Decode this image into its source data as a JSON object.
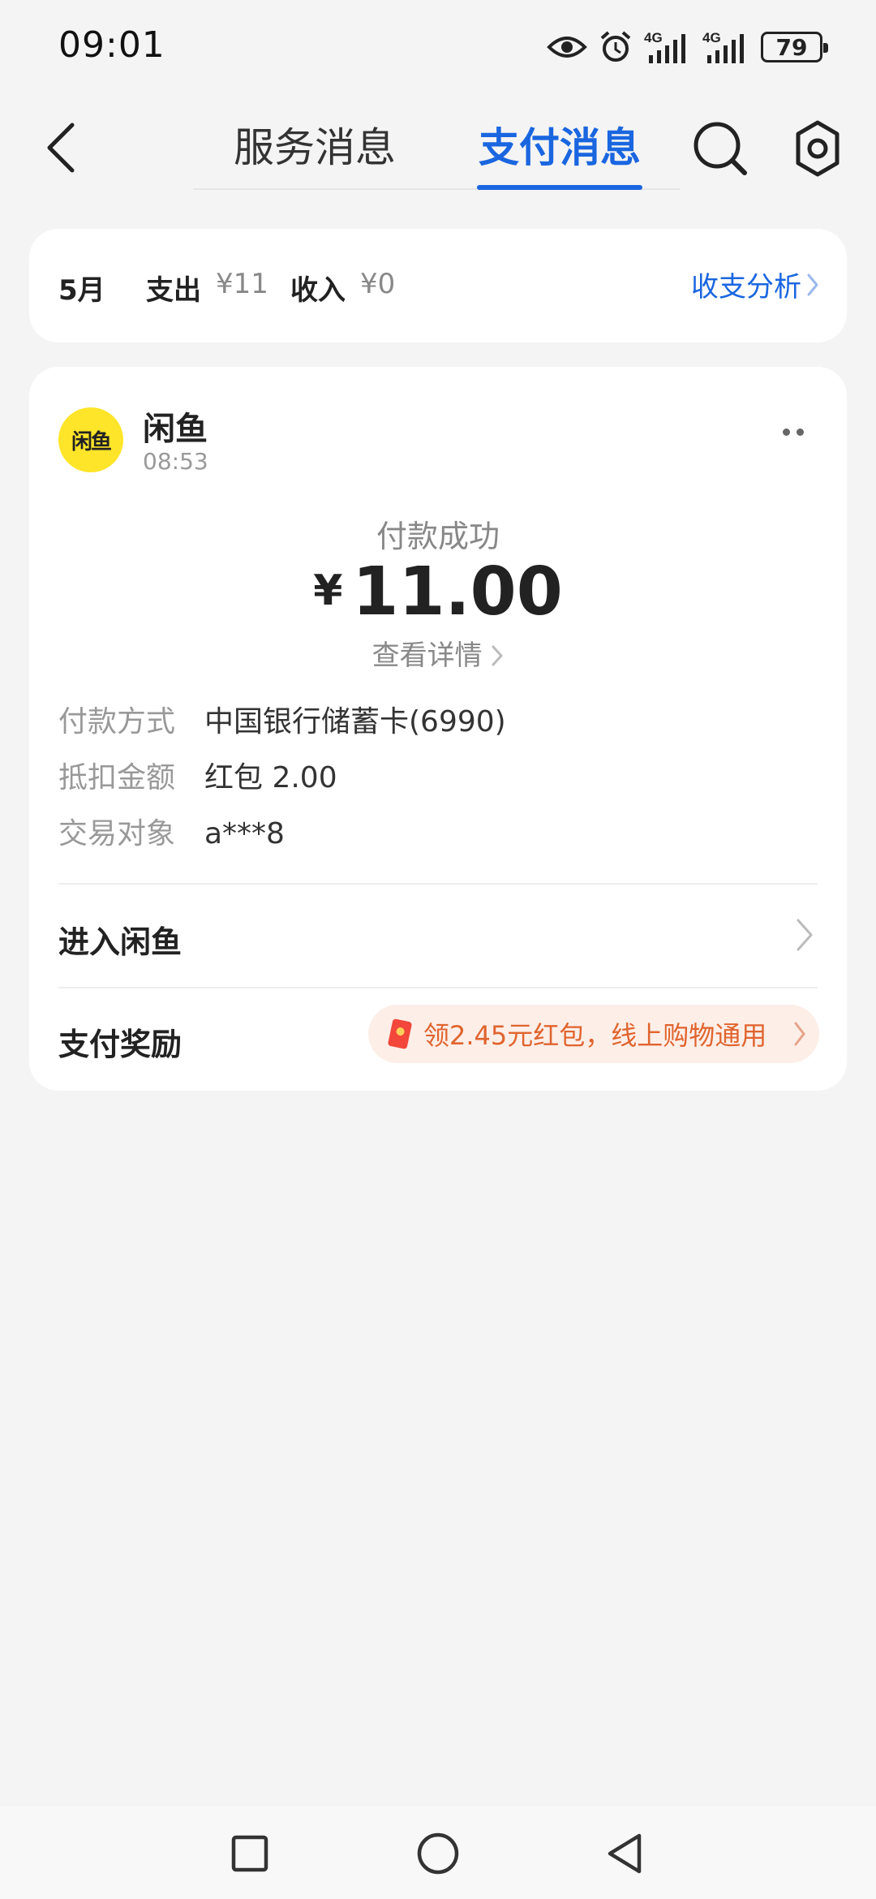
{
  "status_bar": {
    "time": "09:01",
    "battery": "79",
    "icons": [
      "eye-icon",
      "alarm-icon",
      "signal-4g-icon",
      "signal-4g-icon",
      "battery-icon"
    ]
  },
  "header": {
    "tabs": [
      {
        "label": "服务消息",
        "active": false
      },
      {
        "label": "支付消息",
        "active": true
      }
    ],
    "accent_color": "#1a66e0"
  },
  "summary": {
    "month": "5月",
    "expense_label": "支出",
    "expense_value": "¥11",
    "income_label": "收入",
    "income_value": "¥0",
    "analysis_link": "收支分析"
  },
  "message": {
    "merchant_logo_text": "闲鱼",
    "merchant_name": "闲鱼",
    "time": "08:53",
    "status": "付款成功",
    "currency": "¥",
    "amount": "11.00",
    "detail_link": "查看详情",
    "details": [
      {
        "key": "付款方式",
        "value": "中国银行储蓄卡(6990)"
      },
      {
        "key": "抵扣金额",
        "value": "红包 2.00"
      },
      {
        "key": "交易对象",
        "value": "a***8"
      }
    ],
    "enter_label": "进入闲鱼",
    "reward_label": "支付奖励",
    "reward_text": "领2.45元红包，线上购物通用"
  }
}
